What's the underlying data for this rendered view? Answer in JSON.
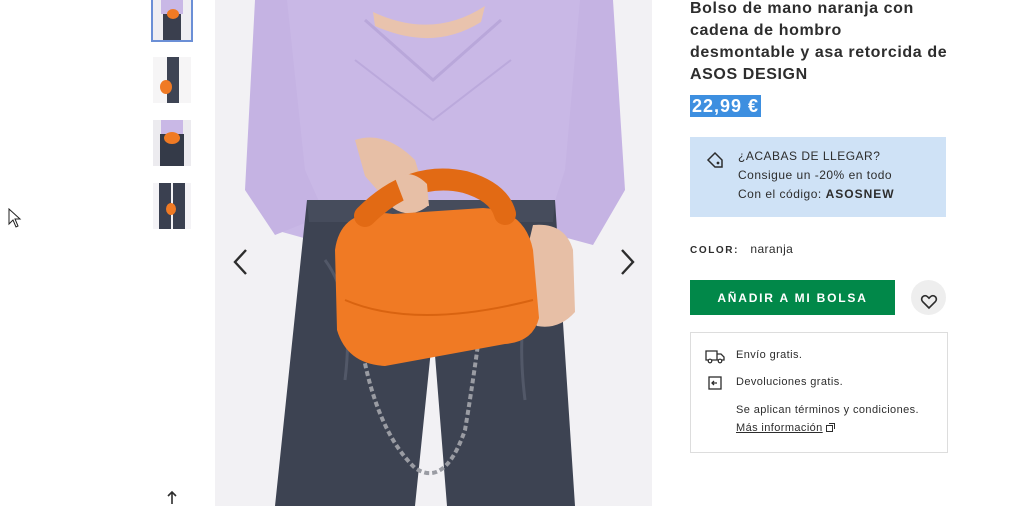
{
  "product": {
    "title": "Bolso de mano naranja con cadena de hombro desmontable y asa retorcida de ASOS DESIGN",
    "price": "22,99 €"
  },
  "promo": {
    "line1": "¿ACABAS DE LLEGAR?",
    "line2": "Consigue un -20% en todo",
    "line3_prefix": "Con el código: ",
    "code": "ASOSNEW",
    "icon": "price-tag-icon"
  },
  "color": {
    "label": "COLOR:",
    "value": "naranja"
  },
  "actions": {
    "add_to_bag": "AÑADIR A MI BOLSA",
    "save_icon": "heart-icon"
  },
  "delivery": {
    "shipping": "Envío gratis.",
    "returns": "Devoluciones gratis.",
    "terms": "Se aplican términos y condiciones.",
    "more_info": "Más información",
    "icons": [
      "truck-icon",
      "returns-icon",
      "external-link-icon"
    ]
  },
  "gallery": {
    "thumbnail_count": 4,
    "active_index": 0,
    "nav_icons": [
      "chevron-left-icon",
      "chevron-right-icon"
    ]
  },
  "colors": {
    "accent_green": "#018849",
    "promo_bg": "#cfe2f6",
    "price_highlight": "#3d8fe0",
    "sweater": "#c9b8e6",
    "bag": "#f07a24"
  }
}
